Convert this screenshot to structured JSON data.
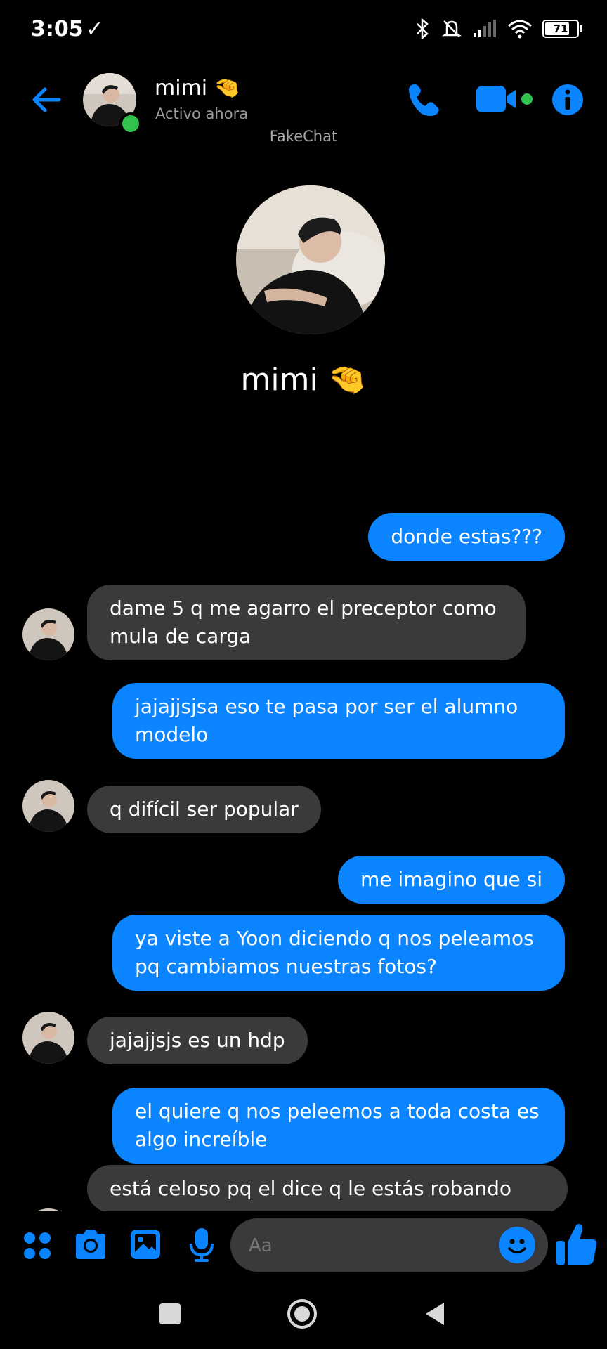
{
  "status_bar": {
    "time": "3:05",
    "battery": "71"
  },
  "header": {
    "name": "mimi 🤏",
    "status": "Activo ahora",
    "watermark": "FakeChat",
    "icons": [
      "back-arrow-icon",
      "phone-icon",
      "video-icon",
      "info-icon"
    ]
  },
  "profile": {
    "name": "mimi 🤏"
  },
  "messages": [
    {
      "side": "sent",
      "text": "donde estas???"
    },
    {
      "side": "received",
      "text": "dame 5 q me agarro el preceptor como mula de carga"
    },
    {
      "side": "sent",
      "text": "jajajjsjsa eso te pasa por ser el alumno modelo"
    },
    {
      "side": "received",
      "text": "q difícil ser popular"
    },
    {
      "side": "sent",
      "text": "me imagino que si"
    },
    {
      "side": "sent",
      "text": "ya viste a Yoon diciendo q nos peleamos pq cambiamos nuestras fotos?"
    },
    {
      "side": "received",
      "text": "jajajjsjs es un hdp"
    },
    {
      "side": "sent",
      "text": "el quiere q nos peleemos a toda costa es algo increíble"
    },
    {
      "side": "received",
      "text": "está celoso pq el dice q le estás robando"
    }
  ],
  "composer": {
    "placeholder": "Aa"
  },
  "colors": {
    "accent": "#0a84ff",
    "received_bubble": "#3a3a3c",
    "online": "#31c24d"
  }
}
